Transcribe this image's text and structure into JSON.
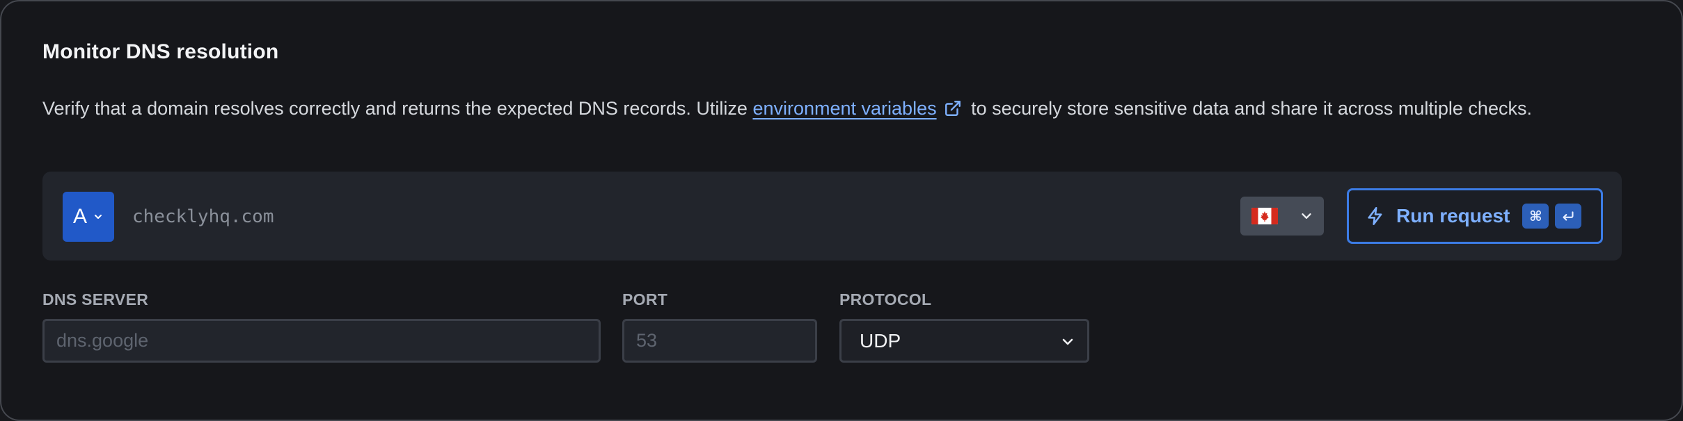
{
  "card": {
    "title": "Monitor DNS resolution",
    "description_before": "Verify that a domain resolves correctly and returns the expected DNS records. Utilize ",
    "description_link": "environment variables",
    "description_after": " to securely store sensitive data and share it across multiple checks."
  },
  "request": {
    "record_type": "A",
    "domain_placeholder": "checklyhq.com",
    "region_flag": "canada-flag-icon",
    "run_label": "Run request",
    "shortcut_keys": [
      "⌘",
      "return-icon"
    ]
  },
  "fields": {
    "dns_server": {
      "label": "DNS SERVER",
      "placeholder": "dns.google",
      "value": ""
    },
    "port": {
      "label": "PORT",
      "placeholder": "53",
      "value": ""
    },
    "protocol": {
      "label": "PROTOCOL",
      "value": "UDP"
    }
  },
  "colors": {
    "accent": "#3c7ce6",
    "link": "#7eb0ff",
    "type_badge": "#2159c8",
    "background": "#16171b"
  }
}
